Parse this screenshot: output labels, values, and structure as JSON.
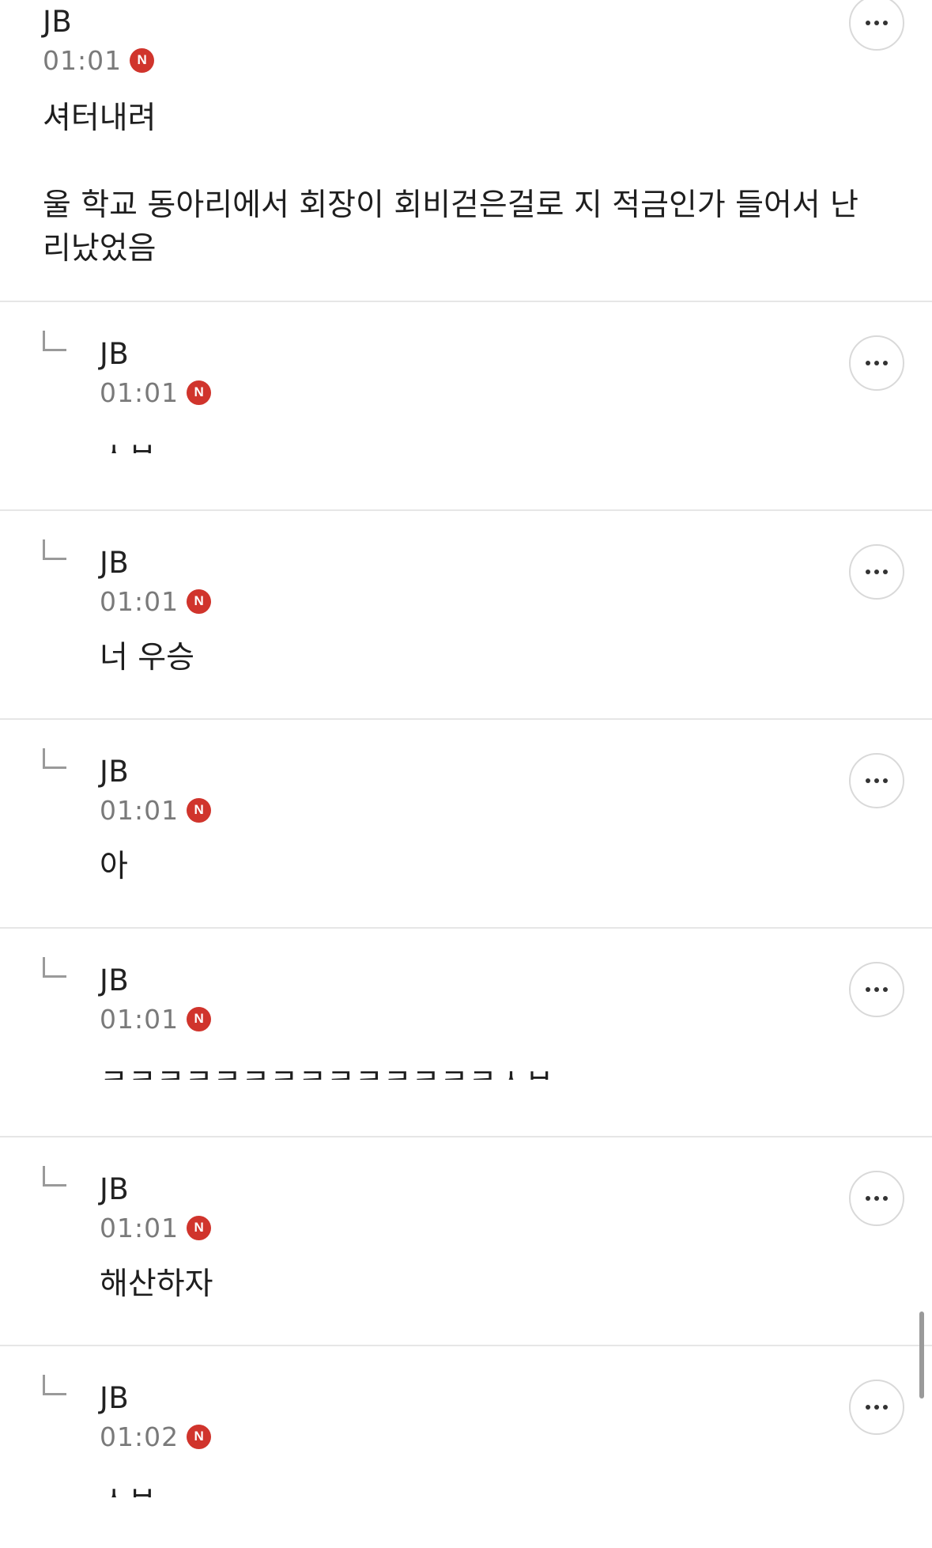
{
  "comments": [
    {
      "author": "JB",
      "time": "01:01",
      "badge": "N",
      "text": "셔터내려\n\n울 학교 동아리에서 회장이 회비걷은걸로 지 적금인가 들어서 난리났었음",
      "more_icon": "more-horizontal-icon"
    }
  ],
  "replies": [
    {
      "author": "JB",
      "time": "01:01",
      "badge": "N",
      "text": "ㅅㅂ"
    },
    {
      "author": "JB",
      "time": "01:01",
      "badge": "N",
      "text": "너 우승"
    },
    {
      "author": "JB",
      "time": "01:01",
      "badge": "N",
      "text": "아"
    },
    {
      "author": "JB",
      "time": "01:01",
      "badge": "N",
      "text": "ㅋㅋㅋㅋㅋㅋㅋㅋㅋㅋㅋㅋㅋㅋㅅㅂ"
    },
    {
      "author": "JB",
      "time": "01:01",
      "badge": "N",
      "text": "해산하자"
    },
    {
      "author": "JB",
      "time": "01:02",
      "badge": "N",
      "text": "ㅅㅂ"
    }
  ],
  "colors": {
    "badge": "#d0342c",
    "time": "#7a7a7a",
    "divider": "#e6e6e6"
  }
}
